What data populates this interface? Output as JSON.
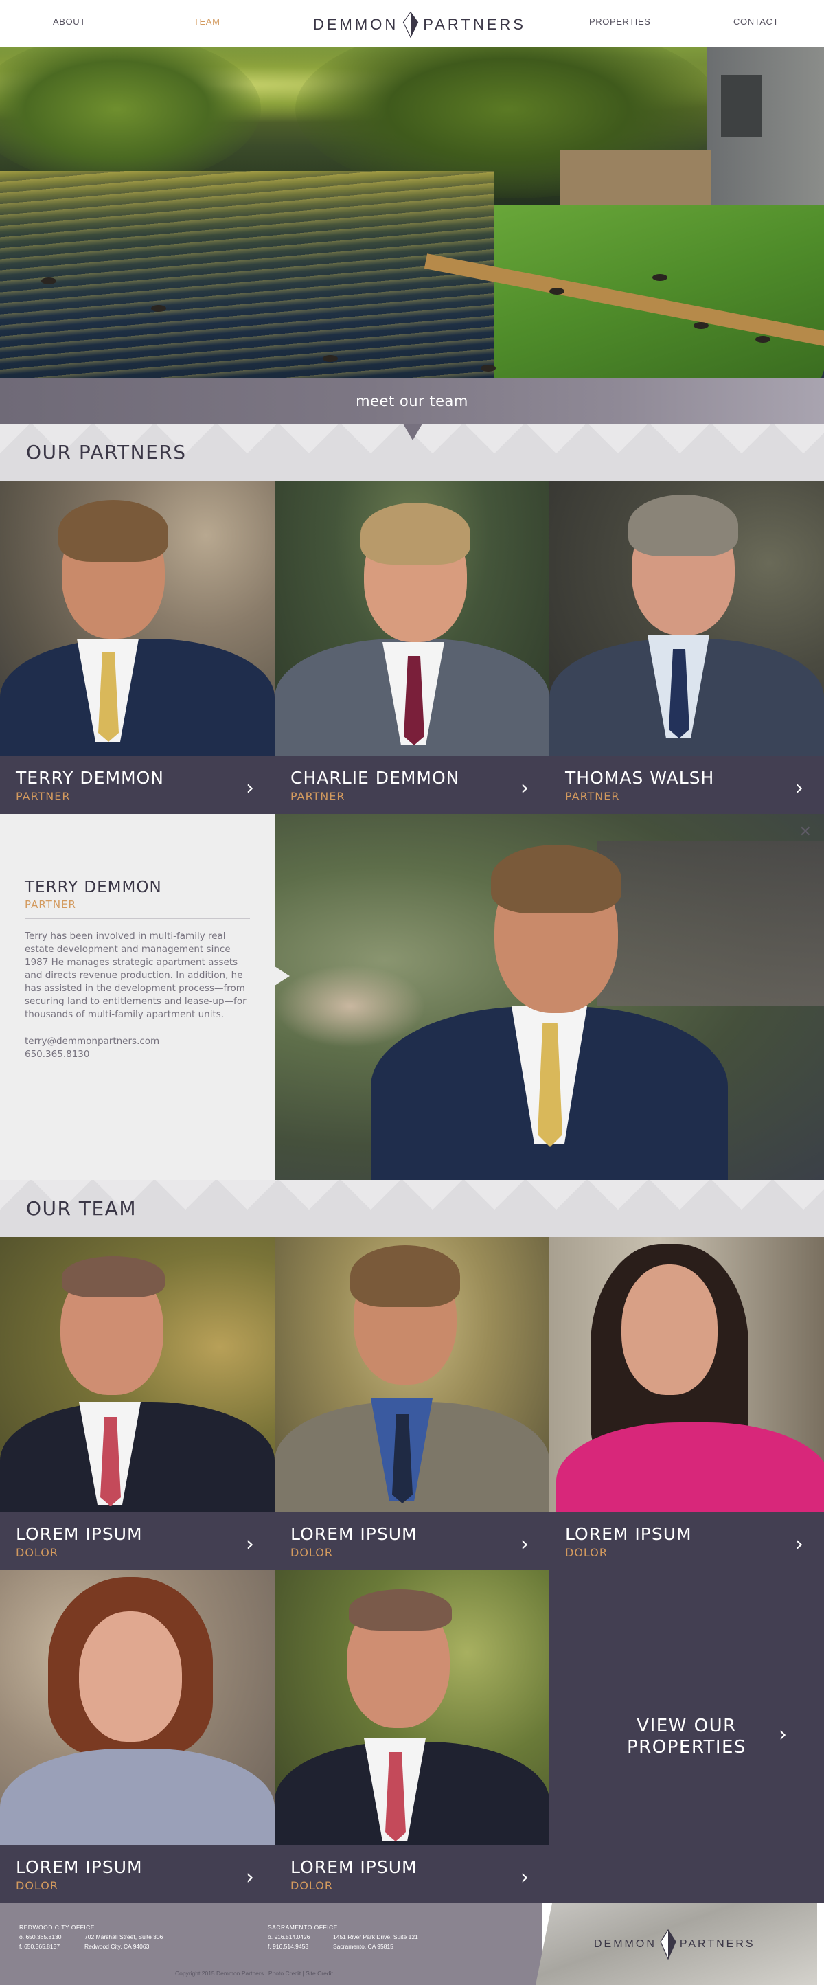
{
  "nav": {
    "about": "ABOUT",
    "team": "TEAM",
    "properties": "PROPERTIES",
    "contact": "CONTACT",
    "logo_left": "DEMMON",
    "logo_right": "PARTNERS"
  },
  "meet": {
    "label": "meet our team"
  },
  "partners": {
    "heading": "OUR PARTNERS",
    "cards": [
      {
        "name": "TERRY DEMMON",
        "role": "PARTNER",
        "tie": "#d9b85a",
        "suit": "#1f2d4c"
      },
      {
        "name": "CHARLIE DEMMON",
        "role": "PARTNER",
        "tie": "#7a1f3a",
        "suit": "#5a6270"
      },
      {
        "name": "THOMAS WALSH",
        "role": "PARTNER",
        "tie": "#23325a",
        "suit": "#3a4458"
      }
    ]
  },
  "detail": {
    "name": "TERRY DEMMON",
    "role": "PARTNER",
    "bio": "Terry has been involved in multi-family real estate development and management since 1987 He manages strategic apartment assets and directs revenue production. In addition, he has assisted in the development process—from securing land to entitlements and lease-up—for thousands of multi-family apartment units.",
    "email": "terry@demmonpartners.com",
    "phone": "650.365.8130",
    "close": "✕"
  },
  "team": {
    "heading": "OUR TEAM",
    "cards": [
      {
        "name": "LOREM IPSUM",
        "role": "DOLOR",
        "tie": "#c44a5a",
        "suit": "#1f2230"
      },
      {
        "name": "LOREM IPSUM",
        "role": "DOLOR",
        "tie": "#1f2a44",
        "suit": "#7d7768"
      },
      {
        "name": "LOREM IPSUM",
        "role": "DOLOR",
        "tie": "#d8277a",
        "suit": "#d8277a"
      },
      {
        "name": "LOREM IPSUM",
        "role": "DOLOR",
        "tie": "#9aa0b8",
        "suit": "#9aa0b8"
      },
      {
        "name": "LOREM IPSUM",
        "role": "DOLOR",
        "tie": "#c44a5a",
        "suit": "#1f2230"
      }
    ],
    "view_properties": "VIEW OUR PROPERTIES"
  },
  "footer": {
    "office1": {
      "title": "REDWOOD CITY OFFICE",
      "phone_o": "o. 650.365.8130",
      "phone_f": "f. 650.365.8137",
      "addr1": "702 Marshall Street, Suite 306",
      "addr2": "Redwood City, CA 94063"
    },
    "office2": {
      "title": "SACRAMENTO OFFICE",
      "phone_o": "o. 916.514.0426",
      "phone_f": "f. 916.514.9453",
      "addr1": "1451 River Park Drive, Suite 121",
      "addr2": "Sacramento, CA 95815"
    },
    "copyright": "Copyright 2015 Demmon Partners | Photo Credit | Site Credit",
    "logo_left": "DEMMON",
    "logo_right": "PARTNERS"
  },
  "colors": {
    "accent": "#d39a5e",
    "brand_dark": "#433f52",
    "bar": "#7d7784"
  }
}
